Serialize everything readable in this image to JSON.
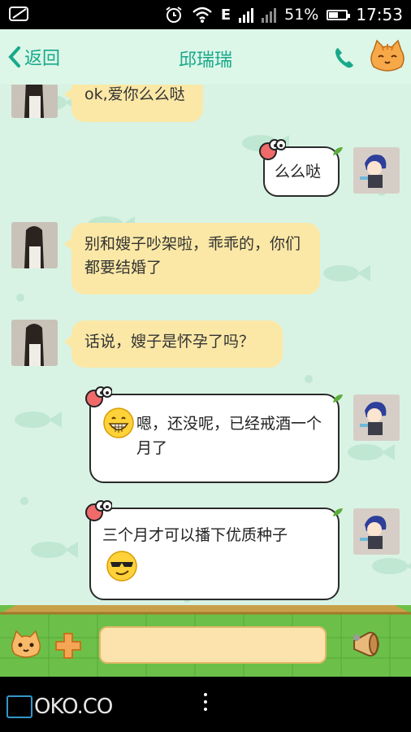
{
  "status_bar": {
    "carrier_2": "E",
    "battery_text": "51%",
    "battery_level": 0.51,
    "time": "17:53",
    "icons": [
      "notification-icon",
      "alarm-icon",
      "wifi-icon",
      "data-e-icon",
      "signal-icon",
      "signal-x-icon",
      "battery-icon"
    ]
  },
  "header": {
    "back_label": "返回",
    "contact_name": "邱瑞瑞",
    "icons": [
      "chevron-left-icon",
      "phone-icon",
      "cat-profile-icon"
    ]
  },
  "messages": [
    {
      "side": "in",
      "text": "ok,爱你么么哒"
    },
    {
      "side": "out",
      "text": "么么哒"
    },
    {
      "side": "in",
      "text": "别和嫂子吵架啦，乖乖的，你们都要结婚了"
    },
    {
      "side": "in",
      "text": "话说，嫂子是怀孕了吗？"
    },
    {
      "side": "out",
      "text": "嗯，还没呢，已经戒酒一个月了",
      "emoji": "grin-emoji"
    },
    {
      "side": "out",
      "text": "三个月才可以播下优质种子",
      "emoji": "sunglasses-emoji"
    }
  ],
  "input_bar": {
    "value": "",
    "icons": [
      "cat-emoji-button",
      "plus-button",
      "horn-voice-button"
    ]
  },
  "nav_bar": {
    "watermark": "OKO.CO",
    "icons": [
      "menu-dots-icon"
    ]
  },
  "colors": {
    "accent": "#17a98a",
    "incoming_bubble": "#fbe8a6",
    "outgoing_bubble": "#ffffff",
    "chat_bg": "#d8f3e4"
  }
}
